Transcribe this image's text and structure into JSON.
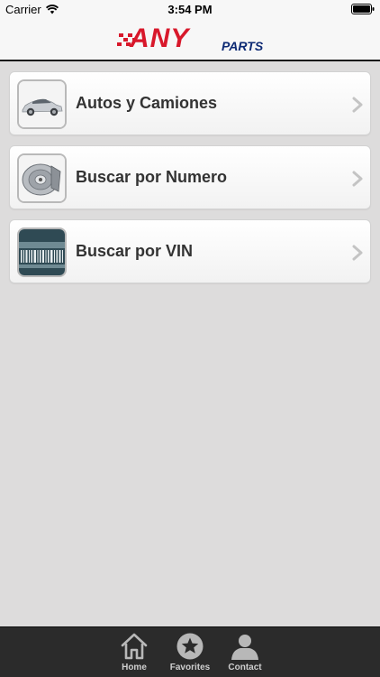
{
  "status_bar": {
    "carrier": "Carrier",
    "time": "3:54 PM"
  },
  "header": {
    "logo_main": "ANY",
    "logo_sub": "PARTS",
    "colors": {
      "logo_red": "#d8182b",
      "logo_blue": "#0d2a74"
    }
  },
  "menu": {
    "items": [
      {
        "label": "Autos y Camiones",
        "icon": "car-icon"
      },
      {
        "label": "Buscar por Numero",
        "icon": "brake-disc-icon"
      },
      {
        "label": "Buscar por VIN",
        "icon": "vin-barcode-icon"
      }
    ]
  },
  "tab_bar": {
    "tabs": [
      {
        "label": "Home",
        "icon": "home-icon"
      },
      {
        "label": "Favorites",
        "icon": "star-icon"
      },
      {
        "label": "Contact",
        "icon": "person-icon"
      }
    ]
  }
}
